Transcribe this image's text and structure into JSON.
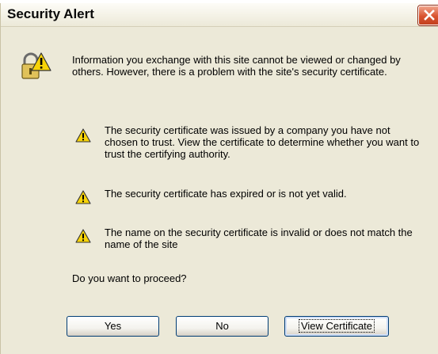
{
  "dialog": {
    "title": "Security Alert",
    "intro": "Information you exchange with this site cannot be viewed or changed by others. However, there is a problem with the site's security certificate.",
    "warnings": [
      "The security certificate was issued by a company you have not chosen to trust. View the certificate to determine whether you want to trust the certifying authority.",
      "The security certificate has expired or is not yet valid.",
      "The name on the security certificate is invalid or does not match the name of the site"
    ],
    "question": "Do you want to proceed?",
    "buttons": {
      "yes": "Yes",
      "no": "No",
      "view_certificate": "View Certificate"
    }
  },
  "icons": {
    "header": "lock-warning-icon",
    "warning": "warning-triangle-icon",
    "close": "close-icon"
  },
  "colors": {
    "dialog_bg": "#ece9d8",
    "close_button": "#d9532f",
    "warning_yellow": "#f7d308",
    "button_border": "#003c74"
  }
}
